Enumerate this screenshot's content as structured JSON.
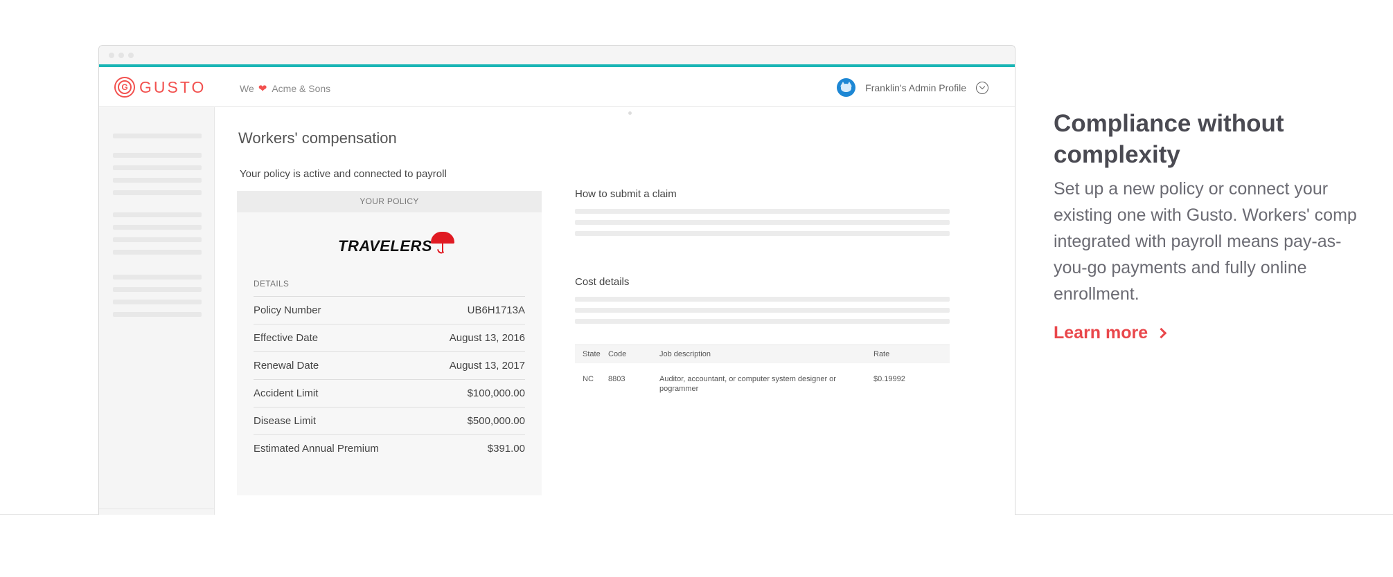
{
  "header": {
    "logo_text": "GUSTO",
    "logo_mark": "G",
    "company_prefix": "We",
    "company_name": "Acme & Sons",
    "profile_name": "Franklin's Admin Profile"
  },
  "main": {
    "title": "Workers' compensation",
    "status": "Your policy is active and connected to payroll",
    "policy_card": {
      "header": "YOUR POLICY",
      "carrier": "TRAVELERS",
      "details_label": "DETAILS",
      "rows": [
        {
          "label": "Policy Number",
          "value": "UB6H1713A"
        },
        {
          "label": "Effective Date",
          "value": "August 13, 2016"
        },
        {
          "label": "Renewal Date",
          "value": "August 13, 2017"
        },
        {
          "label": "Accident Limit",
          "value": "$100,000.00"
        },
        {
          "label": "Disease Limit",
          "value": "$500,000.00"
        },
        {
          "label": "Estimated Annual Premium",
          "value": "$391.00"
        }
      ]
    },
    "claim_title": "How to submit a claim",
    "cost_title": "Cost details",
    "cost_table": {
      "headers": {
        "state": "State",
        "code": "Code",
        "job": "Job description",
        "rate": "Rate"
      },
      "rows": [
        {
          "state": "NC",
          "code": "8803",
          "job": "Auditor, accountant, or computer system designer or pogrammer",
          "rate": "$0.19992"
        }
      ]
    }
  },
  "copy": {
    "title": "Compliance without complexity",
    "body": "Set up a new policy or connect your existing one with Gusto. Workers' comp integrated with payroll means pay-as-you-go payments and fully online enrollment.",
    "link": "Learn more"
  },
  "colors": {
    "brand": "#f2514f",
    "accent_bar": "#19b5b5",
    "link": "#e9474b",
    "travelers_red": "#e01a22"
  },
  "icons": [
    "gusto-logo-icon",
    "heart-icon",
    "avatar-icon",
    "chevron-down-icon",
    "travelers-umbrella-icon",
    "chevron-right-icon"
  ]
}
